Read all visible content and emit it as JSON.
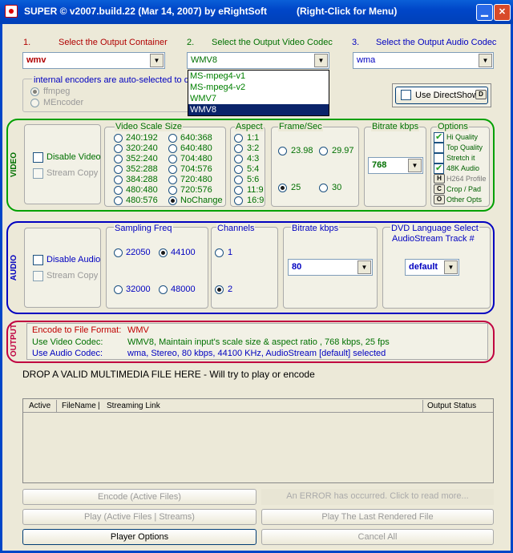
{
  "title": {
    "app": "SUPER © v2007.build.22 (Mar 14, 2007) by eRightSoft",
    "hint": "(Right-Click for Menu)"
  },
  "steps": {
    "s1": "1.",
    "s1t": "Select the Output Container",
    "s2": "2.",
    "s2t": "Select the Output Video Codec",
    "s3": "3.",
    "s3t": "Select the Output Audio Codec"
  },
  "container": "wmv",
  "video_codec": "WMV8",
  "audio_codec": "wma",
  "codec_options": [
    "MS-mpeg4-v1",
    "MS-mpeg4-v2",
    "WMV7",
    "WMV8"
  ],
  "encoders": {
    "title": "internal encoders are auto-selected to d",
    "ffmpeg": "ffmpeg",
    "mencoder": "MEncoder"
  },
  "directshow": "Use DirectShow",
  "directshow_key": "D",
  "video": {
    "label": "VIDEO",
    "disable": "Disable Video",
    "stream_copy": "Stream Copy",
    "scale_title": "Video Scale Size",
    "scales_left": [
      "240:192",
      "320:240",
      "352:240",
      "352:288",
      "384:288",
      "480:480",
      "480:576"
    ],
    "scales_right": [
      "640:368",
      "640:480",
      "704:480",
      "704:576",
      "720:480",
      "720:576",
      "NoChange"
    ],
    "aspect_title": "Aspect",
    "aspects": [
      "1:1",
      "3:2",
      "4:3",
      "5:4",
      "5:6",
      "11:9",
      "16:9"
    ],
    "fps_title": "Frame/Sec",
    "fps": [
      "23.98",
      "29.97",
      "25",
      "30"
    ],
    "bitrate_title": "Bitrate  kbps",
    "bitrate": "768",
    "options_title": "Options",
    "options": [
      {
        "key": "",
        "label": "Hi Quality"
      },
      {
        "key": "",
        "label": "Top Quality"
      },
      {
        "key": "",
        "label": "Stretch it"
      },
      {
        "key": "",
        "label": "48K Audio"
      },
      {
        "key": "H",
        "label": "H264 Profile"
      },
      {
        "key": "C",
        "label": "Crop / Pad"
      },
      {
        "key": "O",
        "label": "Other Opts"
      }
    ]
  },
  "audio": {
    "label": "AUDIO",
    "disable": "Disable Audio",
    "stream_copy": "Stream Copy",
    "freq_title": "Sampling Freq",
    "freqs": [
      "22050",
      "44100",
      "32000",
      "48000"
    ],
    "channels_title": "Channels",
    "channels": [
      "1",
      "2"
    ],
    "bitrate_title": "Bitrate  kbps",
    "bitrate": "80",
    "dvd_title": "DVD Language Select",
    "dvd_sub": "AudioStream  Track #",
    "dvd_value": "default"
  },
  "output": {
    "label": "OUTPUT",
    "fmt_label": "Encode to File Format:",
    "fmt_val": "WMV",
    "vc_label": "Use Video Codec:",
    "vc_val": "WMV8,  Maintain input's scale size & aspect ratio ,  768 kbps,  25 fps",
    "ac_label": "Use Audio Codec:",
    "ac_val": "wma,  Stereo,  80 kbps,  44100 KHz,  AudioStream [default] selected"
  },
  "drop_text": "DROP A VALID MULTIMEDIA FILE HERE - Will try to play or encode",
  "table": {
    "active": "Active",
    "filename": "FileName",
    "sep": "|",
    "link": "Streaming Link",
    "status": "Output Status"
  },
  "buttons": {
    "encode": "Encode (Active Files)",
    "error": "An ERROR has occurred. Click to read more...",
    "play": "Play (Active Files | Streams)",
    "play_last": "Play The Last Rendered File",
    "player_opts": "Player Options",
    "cancel": "Cancel All"
  }
}
